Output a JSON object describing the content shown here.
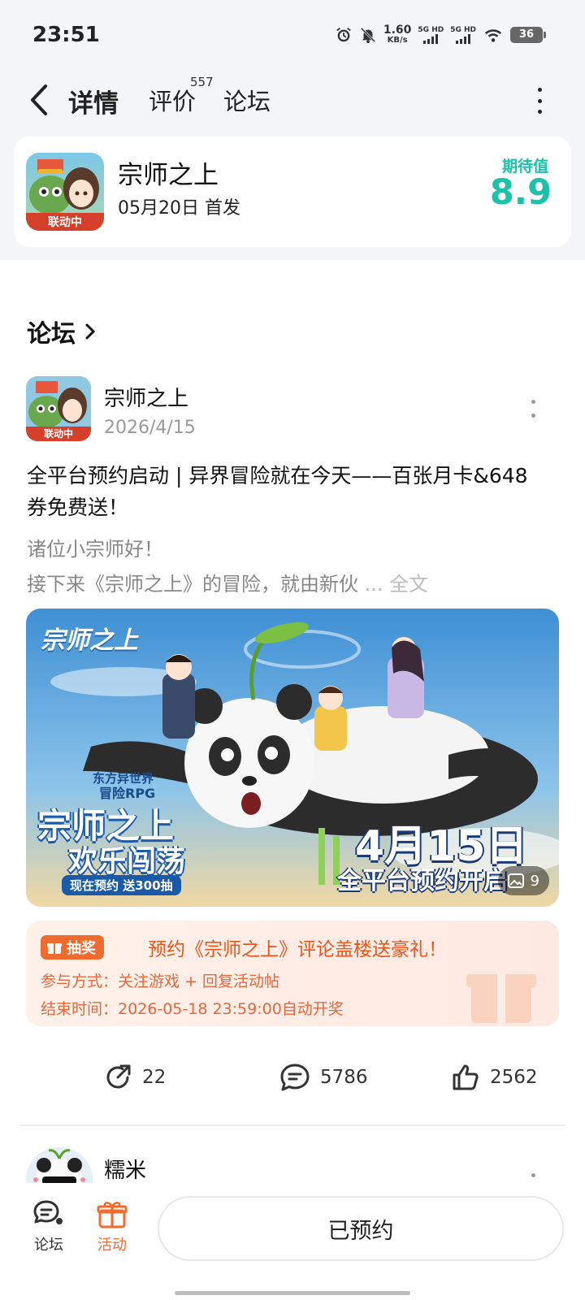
{
  "status_bar": {
    "time": "23:51",
    "net_speed_value": "1.60",
    "net_speed_unit": "KB/s",
    "sim1": "5G HD",
    "sim2": "5G HD",
    "battery": "36",
    "icons": [
      "alarm-icon",
      "mute-icon",
      "wifi-icon",
      "battery-icon"
    ]
  },
  "nav": {
    "tabs": [
      {
        "label": "详情",
        "active": true
      },
      {
        "label": "评价",
        "badge": "557"
      },
      {
        "label": "论坛"
      }
    ]
  },
  "game": {
    "name": "宗师之上",
    "release": "05月20日 首发",
    "icon_tag": "联动中",
    "expect_label": "期待值",
    "expect_score": "8.9"
  },
  "forum": {
    "section_title": "论坛",
    "post": {
      "author": "宗师之上",
      "date": "2026/4/15",
      "icon_tag": "联动中",
      "title": "全平台预约启动 | 异界冒险就在今天——百张月卡&648券免费送！",
      "excerpt_line1": "诸位小宗师好！",
      "excerpt_line2": "接下来《宗师之上》的冒险，就由新伙",
      "excerpt_more": " ... 全文",
      "banner": {
        "logo": "宗师之上",
        "tagline_small": "东方异世界",
        "tagline_rpg": "冒险RPG",
        "headline1": "宗师之上",
        "headline2": "欢乐闯荡",
        "promo": "现在预约 送300抽",
        "date": "4月15日",
        "subdate": "全平台预约开启",
        "image_count": "9"
      },
      "lottery": {
        "badge": "抽奖",
        "title": "预约《宗师之上》评论盖楼送豪礼！",
        "line1": "参与方式：关注游戏 + 回复活动帖",
        "line2": "结束时间：2026-05-18 23:59:00自动开奖"
      },
      "stats": {
        "shares": "22",
        "comments": "5786",
        "likes": "2562"
      }
    },
    "next_post": {
      "author": "糯米"
    }
  },
  "bottom_bar": {
    "forum_label": "论坛",
    "activity_label": "活动",
    "reserve_label": "已预约"
  },
  "colors": {
    "accent_teal": "#19c2a8",
    "accent_orange": "#f06b2e",
    "background_gray": "#f4f5f7"
  }
}
